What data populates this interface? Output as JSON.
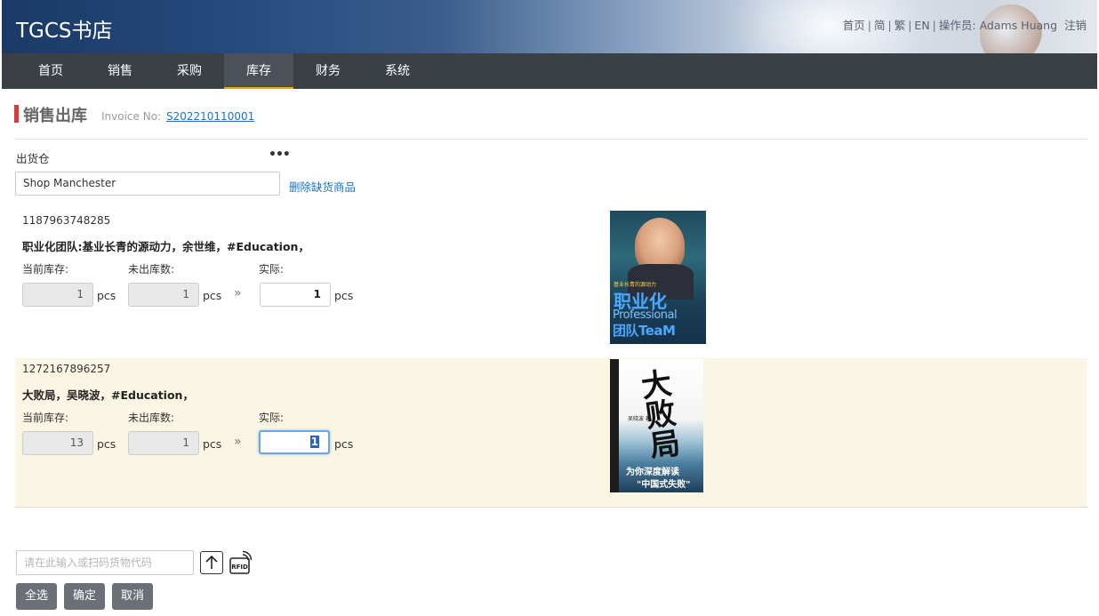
{
  "header": {
    "logo": "TGCS书店",
    "links": [
      "首页",
      "简",
      "繁",
      "EN"
    ],
    "operator_label": "操作员:",
    "operator_name": "Adams Huang",
    "logout": "注销"
  },
  "nav": {
    "items": [
      "首页",
      "销售",
      "采购",
      "库存",
      "财务",
      "系统"
    ],
    "active": "库存"
  },
  "page": {
    "title": "销售出库",
    "invoice_label": "Invoice No:",
    "invoice_no": "S202210110001"
  },
  "warehouse": {
    "label": "出货仓",
    "more": "•••",
    "value": "Shop Manchester",
    "remove_link": "删除缺货商品"
  },
  "labels": {
    "current_stock": "当前库存:",
    "pending_out": "未出库数:",
    "actual": "实际:",
    "unit": "pcs",
    "arrow": "»"
  },
  "items": [
    {
      "barcode": "1187963748285",
      "title": "职业化团队:基业长青的源动力，余世维，#Education，",
      "current_stock": "1",
      "pending_out": "1",
      "actual": "1",
      "cover_big_text": "职业化",
      "cover_en_1": "Professional",
      "cover_en_2": "团队TeaM",
      "cover_small": "基业长青的源动力"
    },
    {
      "barcode": "1272167896257",
      "title": "大败局，吴晓波，#Education，",
      "current_stock": "13",
      "pending_out": "1",
      "actual": "1",
      "cover_big_text": "大败局",
      "cover_sub_1": "为你深度解读",
      "cover_sub_2": "\"中国式失败\"",
      "cover_author": "吴晓波 著"
    }
  ],
  "bottom": {
    "code_placeholder": "请在此输入或扫码货物代码",
    "rfid_label": "RFID",
    "select_all": "全选",
    "confirm": "确定",
    "cancel": "取消"
  }
}
